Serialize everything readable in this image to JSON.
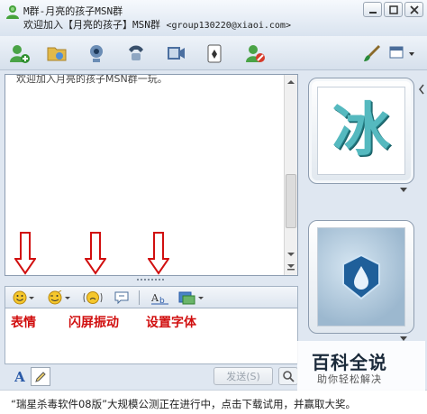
{
  "window": {
    "title_line1": "M群-月亮的孩子MSN群",
    "title_line2_prefix": "欢迎加入【月亮的孩子】MSN群",
    "title_line2_email": "<group130220@xiaoi.com>"
  },
  "toolbar": {
    "buttons": [
      "invite-contact",
      "send-files",
      "video-call",
      "voice-call",
      "activities",
      "games",
      "block"
    ],
    "right_icons": [
      "paint-brush",
      "layout"
    ]
  },
  "history": {
    "partial_text": "欢迎加入月亮的孩子MSN群一玩。"
  },
  "emote_bar": {
    "buttons": [
      "emoticon",
      "wink",
      "nudge",
      "voice-clip",
      "font",
      "background"
    ]
  },
  "annotations": {
    "emoticon_label": "表情",
    "nudge_label": "闪屏振动",
    "font_label": "设置字体",
    "arrow_color": "#d10f0f"
  },
  "compose": {
    "send_label": "发送(S)"
  },
  "status": {
    "text": "“瑞星杀毒软件08版”大规模公测正在进行中，点击下载试用，并赢取大奖。"
  },
  "avatar": {
    "character": "冰"
  },
  "watermark": {
    "title": "百科全说",
    "subtitle": "助你轻松解决"
  }
}
